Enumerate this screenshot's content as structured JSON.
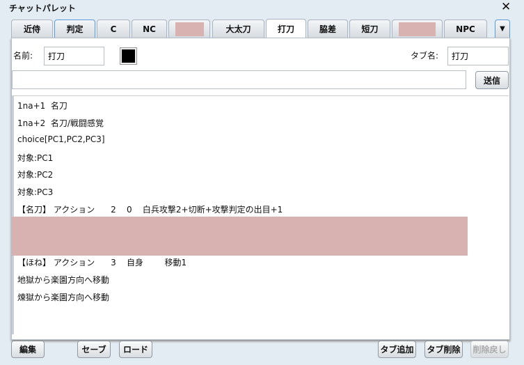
{
  "title": "チャットパレット",
  "tabs": [
    "近侍",
    "判定",
    "C",
    "NC",
    "",
    "大太刀",
    "打刀",
    "脇差",
    "短刀",
    "",
    "NPC"
  ],
  "name_label": "名前:",
  "name_value": "打刀",
  "tabname_label": "タブ名:",
  "tabname_value": "打刀",
  "chat_input": "",
  "send": "送信",
  "lines": [
    "1na+1  名刀",
    "1na+2  名刀/戦闘感覚",
    "choice[PC1,PC2,PC3]",
    "対象:PC1",
    "対象:PC2",
    "対象:PC3",
    "【名刀】 アクション      2    0    白兵攻撃2+切断+攻撃判定の出目+1",
    "【ほね】 アクション      3    自身        移動1",
    "地獄から楽園方向へ移動",
    "煉獄から楽園方向へ移動"
  ],
  "buttons": {
    "edit": "編集",
    "save": "セーブ",
    "load": "ロード",
    "add_tab": "タブ追加",
    "delete_tab": "タブ削除",
    "undo_delete": "削除戻し"
  },
  "colors": {
    "redaction": "#d8b1b1",
    "color_swatch": "#000000"
  }
}
